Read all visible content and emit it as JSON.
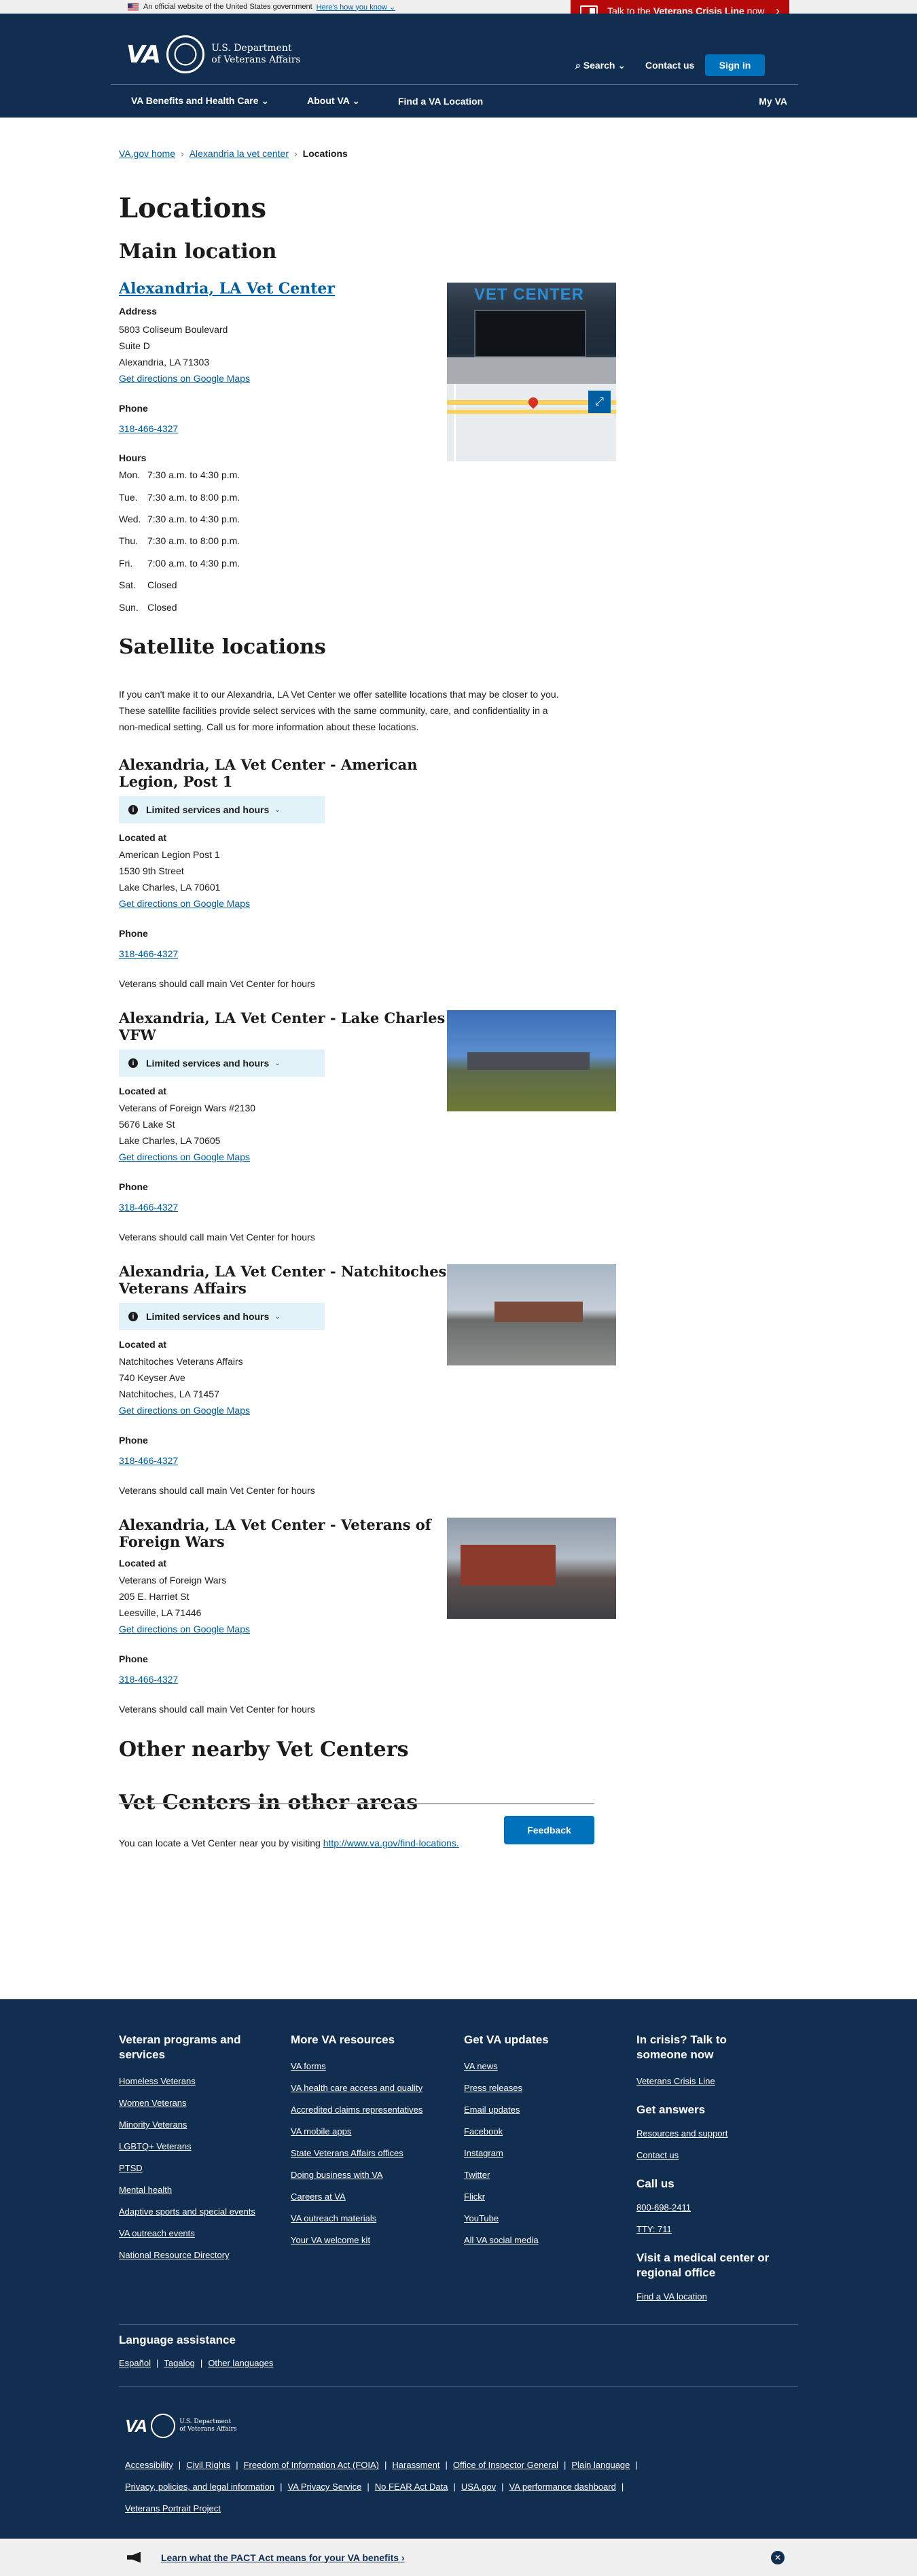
{
  "banner": {
    "official": "An official website of the United States government",
    "how_you_know": "Here's how you know",
    "crisis_prefix": "Talk to the",
    "crisis_bold": "Veterans Crisis Line",
    "crisis_suffix": "now"
  },
  "header": {
    "logo_va": "VA",
    "dept_line1": "U.S. Department",
    "dept_line2": "of Veterans Affairs",
    "search": "Search",
    "contact": "Contact us",
    "signin": "Sign in",
    "nav": [
      "VA Benefits and Health Care",
      "About VA",
      "Find a VA Location"
    ],
    "myva": "My VA"
  },
  "breadcrumb": [
    "VA.gov home",
    "Alexandria la vet center",
    "Locations"
  ],
  "page": {
    "title": "Locations",
    "main_heading": "Main location",
    "main": {
      "name": "Alexandria, LA Vet Center",
      "address_label": "Address",
      "address": [
        "5803 Coliseum Boulevard",
        "Suite D",
        "Alexandria, LA 71303"
      ],
      "directions": "Get directions on Google Maps",
      "phone_label": "Phone",
      "phone": "318-466-4327",
      "hours_label": "Hours",
      "photo_sign": "VET CENTER",
      "hours": [
        {
          "day": "Mon.",
          "time": "7:30 a.m. to 4:30 p.m."
        },
        {
          "day": "Tue.",
          "time": "7:30 a.m. to 8:00 p.m."
        },
        {
          "day": "Wed.",
          "time": "7:30 a.m. to 4:30 p.m."
        },
        {
          "day": "Thu.",
          "time": "7:30 a.m. to 8:00 p.m."
        },
        {
          "day": "Fri.",
          "time": "7:00 a.m. to 4:30 p.m."
        },
        {
          "day": "Sat.",
          "time": "Closed"
        },
        {
          "day": "Sun.",
          "time": "Closed"
        }
      ]
    },
    "satellite_heading": "Satellite locations",
    "satellite_intro": [
      "If you can't make it to our Alexandria, LA Vet Center we offer satellite locations that may be closer to you.",
      "These satellite facilities provide select services with the same community, care, and confidentiality in a",
      "non-medical setting. Call us for more information about these locations."
    ],
    "limited": "Limited services and hours",
    "located_label": "Located at",
    "phone_label": "Phone",
    "call_note": "Veterans should call main Vet Center for hours",
    "satellites": [
      {
        "name1": "Alexandria, LA Vet Center - American",
        "name2": "Legion, Post 1",
        "addr": [
          "American Legion Post 1",
          "1530 9th Street",
          "Lake Charles, LA 70601"
        ],
        "phone": "318-466-4327"
      },
      {
        "name1": "Alexandria, LA Vet Center - Lake Charles",
        "name2": "VFW",
        "addr": [
          "Veterans of Foreign Wars #2130",
          "5676 Lake St",
          "Lake Charles, LA 70605"
        ],
        "phone": "318-466-4327"
      },
      {
        "name1": "Alexandria, LA Vet Center - Natchitoches",
        "name2": "Veterans Affairs",
        "addr": [
          "Natchitoches Veterans Affairs",
          "740 Keyser Ave",
          "Natchitoches, LA 71457"
        ],
        "phone": "318-466-4327"
      },
      {
        "name1": "Alexandria, LA Vet Center - Veterans of",
        "name2": "Foreign Wars",
        "addr": [
          "Veterans of Foreign Wars",
          "205 E. Harriet St",
          "Leesville, LA 71446"
        ],
        "phone": "318-466-4327"
      }
    ],
    "directions": "Get directions on Google Maps",
    "nearby_heading": "Other nearby Vet Centers",
    "other_heading": "Vet Centers in other areas",
    "other_text": "You can locate a Vet Center near you by visiting",
    "other_link": "http://www.va.gov/find-locations.",
    "feedback": "Feedback"
  },
  "footer": {
    "col1": {
      "title1": "Veteran programs and",
      "title2": "services",
      "links": [
        "Homeless Veterans",
        "Women Veterans",
        "Minority Veterans",
        "LGBTQ+ Veterans",
        "PTSD",
        "Mental health",
        "Adaptive sports and special events",
        "VA outreach events",
        "National Resource Directory"
      ]
    },
    "col2": {
      "title": "More VA resources",
      "links": [
        "VA forms",
        "VA health care access and quality",
        "Accredited claims representatives",
        "VA mobile apps",
        "State Veterans Affairs offices",
        "Doing business with VA",
        "Careers at VA",
        "VA outreach materials",
        "Your VA welcome kit"
      ]
    },
    "col3": {
      "title": "Get VA updates",
      "links": [
        "VA news",
        "Press releases",
        "Email updates",
        "Facebook",
        "Instagram",
        "Twitter",
        "Flickr",
        "YouTube",
        "All VA social media"
      ]
    },
    "col4": {
      "title1": "In crisis? Talk to",
      "title2": "someone now",
      "crisis_link": "Veterans Crisis Line",
      "answers_title": "Get answers",
      "answers": [
        "Resources and support",
        "Contact us"
      ],
      "call_title": "Call us",
      "calls": [
        "800-698-2411",
        "TTY: 711"
      ],
      "visit_title1": "Visit a medical center or",
      "visit_title2": "regional office",
      "visit_link": "Find a VA location"
    },
    "language_title": "Language assistance",
    "languages": [
      "Español",
      "Tagalog",
      "Other languages"
    ],
    "legal1": [
      "Accessibility",
      "Civil Rights",
      "Freedom of Information Act (FOIA)",
      "Harassment",
      "Office of Inspector General",
      "Plain language"
    ],
    "legal2": [
      "Privacy, policies, and legal information",
      "VA Privacy Service",
      "No FEAR Act Data",
      "USA.gov",
      "VA performance dashboard"
    ],
    "legal3": [
      "Veterans Portrait Project"
    ]
  },
  "pact": {
    "text": "Learn what the PACT Act means for your VA benefits"
  }
}
